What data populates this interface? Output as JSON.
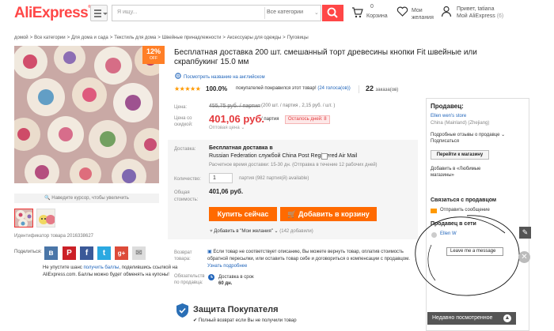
{
  "header": {
    "logo": "AliExpress",
    "search_placeholder": "Я ищу...",
    "search_category": "Все категории",
    "cart_label": "Корзина",
    "cart_count": "0",
    "wish_line1": "Мои",
    "wish_line2": "желания",
    "greet_line1": "Привет, tatiana",
    "greet_line2": "Мой AliExpress",
    "greet_count": "(6)"
  },
  "breadcrumb": [
    "домой",
    "Все категории",
    "Для дома и сада",
    "Текстиль для дома",
    "Швейные принадлежности",
    "Аксессуары для одежды",
    "Пуговицы"
  ],
  "gallery": {
    "discount": "12%",
    "discount_sub": "OFF",
    "hover_hint": "Наведите курсор, чтобы увеличить",
    "item_id": "Идентификатор товара 2016338627",
    "share_label": "Поделиться:",
    "coupon_pre": "Не упустите шанс ",
    "coupon_link": "получить баллы",
    "coupon_post": ", поделившись ссылкой на AliExpress.com. Баллы можно будет обменять на купоны!"
  },
  "product": {
    "title": "Бесплатная доставка 200 шт. смешанный торт древесины кнопки Fit швейные или скрапбукинг 15.0 мм",
    "translate_link": "Посмотреть название на английском",
    "stars": "★★★★★",
    "rating_pct": "100.0%",
    "rating_text": "покупателей понравился этот товар!",
    "rating_votes": "(24 голоса(ов))",
    "orders_count": "22",
    "orders_label": "заказа(ов)",
    "price_label": "Цена:",
    "old_price": "455,75 руб. / партия",
    "old_note": "(200 шт. / партия , 2,15 руб. / шт. )",
    "sale_label": "Цена со скидкой:",
    "sale_price": "401,06 руб.",
    "per_lot": "/ партия",
    "days_left": "Осталось дней: 8",
    "wholesale": "Оптовая цена",
    "ship_label": "Доставка:",
    "ship_title": "Бесплатная доставка в",
    "ship_method": "Russian Federation службой China Post Registered Air Mail",
    "ship_time": "Расчетное время доставки: 15-30 дн. (Отправка в течение 12 рабочих дней)",
    "qty_label": "Количество:",
    "qty_value": "1",
    "qty_note": "партия (982 партия(й) available)",
    "total_label1": "Общая",
    "total_label2": "стоимость:",
    "total_value": "401,06 руб.",
    "buy_now": "Купить сейчас",
    "add_cart": "Добавить в корзину",
    "wishlist_add": "Добавить в \"Мои желания\"",
    "wishlist_count": "(142 добавили)",
    "return_label1": "Возврат",
    "return_label2": "товара:",
    "return_text": "Если товар не соответствует описанию, Вы можете вернуть товар, оплатив стоимость обратной пересылки, или оставить товар себе и договориться о компенсации с продавцом.",
    "return_more": "Узнать подробнее",
    "deliv_label1": "Обязательств",
    "deliv_label2": "по продавца:",
    "deliv_text1": "Доставка в срок",
    "deliv_text2": "60 дн.",
    "protect_title": "Защита Покупателя",
    "protect_item1": "Полный возврат если Вы не получили товар"
  },
  "seller": {
    "heading": "Продавец:",
    "store_name": "Ellen wen's store",
    "store_location": "China (Mainland) (Zhejiang)",
    "subscribe1": "Подробные отзывы о продавце",
    "subscribe2": "Подписаться",
    "store_button": "Перейти к магазину",
    "fav1": "Добавить в «Любимые",
    "fav2": "магазины»",
    "contact_heading": "Связаться с продавцом",
    "message_link": "Отправить сообщение",
    "online_heading": "Продавец в сети",
    "online_user": "Ellen W",
    "tooltip": "Leave me a message"
  },
  "floating": {
    "recent": "Недавно посмотренное"
  }
}
